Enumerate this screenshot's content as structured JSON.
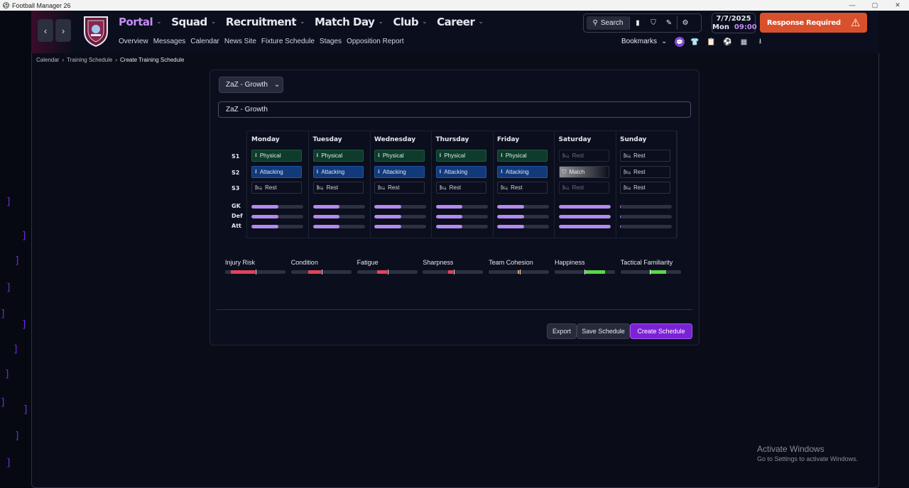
{
  "window": {
    "title": "Football Manager 26",
    "controls": [
      "—",
      "▢",
      "✕"
    ]
  },
  "nav": {
    "items": [
      {
        "label": "Portal",
        "active": true
      },
      {
        "label": "Squad"
      },
      {
        "label": "Recruitment"
      },
      {
        "label": "Match Day"
      },
      {
        "label": "Club"
      },
      {
        "label": "Career"
      }
    ],
    "sub": [
      "Overview",
      "Messages",
      "Calendar",
      "News Site",
      "Fixture Schedule",
      "Stages",
      "Opposition Report"
    ]
  },
  "toolbar": {
    "search_label": "Search",
    "bookmarks_label": "Bookmarks"
  },
  "date": {
    "date": "7/7/2025",
    "day": "Mon",
    "time": "09:00"
  },
  "response": {
    "label": "Response Required"
  },
  "breadcrumb": {
    "items": [
      "Calendar",
      "Training Schedule",
      "Create Training Schedule"
    ]
  },
  "schedule": {
    "dropdown_value": "ZaZ - Growth",
    "name_value": "ZaZ - Growth",
    "row_labels": {
      "s1": "S1",
      "s2": "S2",
      "s3": "S3",
      "gk": "GK",
      "def": "Def",
      "att": "Att"
    },
    "days": [
      {
        "name": "Monday",
        "s1": "Physical",
        "s2": "Attacking",
        "s3": "Rest",
        "gk": 0.52,
        "def": 0.52,
        "att": 0.52
      },
      {
        "name": "Tuesday",
        "s1": "Physical",
        "s2": "Attacking",
        "s3": "Rest",
        "gk": 0.52,
        "def": 0.52,
        "att": 0.52
      },
      {
        "name": "Wednesday",
        "s1": "Physical",
        "s2": "Attacking",
        "s3": "Rest",
        "gk": 0.52,
        "def": 0.52,
        "att": 0.52
      },
      {
        "name": "Thursday",
        "s1": "Physical",
        "s2": "Attacking",
        "s3": "Rest",
        "gk": 0.52,
        "def": 0.52,
        "att": 0.52
      },
      {
        "name": "Friday",
        "s1": "Physical",
        "s2": "Attacking",
        "s3": "Rest",
        "gk": 0.52,
        "def": 0.52,
        "att": 0.52
      },
      {
        "name": "Saturday",
        "s1": "Rest",
        "s2": "Match",
        "s3": "Rest",
        "gk": 1.0,
        "def": 1.0,
        "att": 1.0
      },
      {
        "name": "Sunday",
        "s1": "Rest",
        "s2": "Rest",
        "s3": "Rest",
        "gk": 0.02,
        "def": 0.02,
        "att": 0.02
      }
    ]
  },
  "metrics": [
    {
      "label": "Injury Risk",
      "color": "#e2425b",
      "from": 0.09,
      "to": 0.5,
      "tick": 0.51
    },
    {
      "label": "Condition",
      "color": "#e2425b",
      "from": 0.28,
      "to": 0.5,
      "tick": 0.51
    },
    {
      "label": "Fatigue",
      "color": "#e2425b",
      "from": 0.33,
      "to": 0.5,
      "tick": 0.51
    },
    {
      "label": "Sharpness",
      "color": "#e2425b",
      "from": 0.42,
      "to": 0.5,
      "tick": 0.51
    },
    {
      "label": "Team Cohesion",
      "color": "#e8a23a",
      "from": 0.48,
      "to": 0.5,
      "tick": 0.51
    },
    {
      "label": "Happiness",
      "color": "#5ad84a",
      "from": 0.5,
      "to": 0.83,
      "tick": 0.49
    },
    {
      "label": "Tactical Familiarity",
      "color": "#5ad84a",
      "from": 0.5,
      "to": 0.76,
      "tick": 0.49
    }
  ],
  "buttons": {
    "export": "Export",
    "save": "Save Schedule",
    "create": "Create Schedule"
  },
  "watermark": {
    "line1": "Activate Windows",
    "line2": "Go to Settings to activate Windows."
  }
}
